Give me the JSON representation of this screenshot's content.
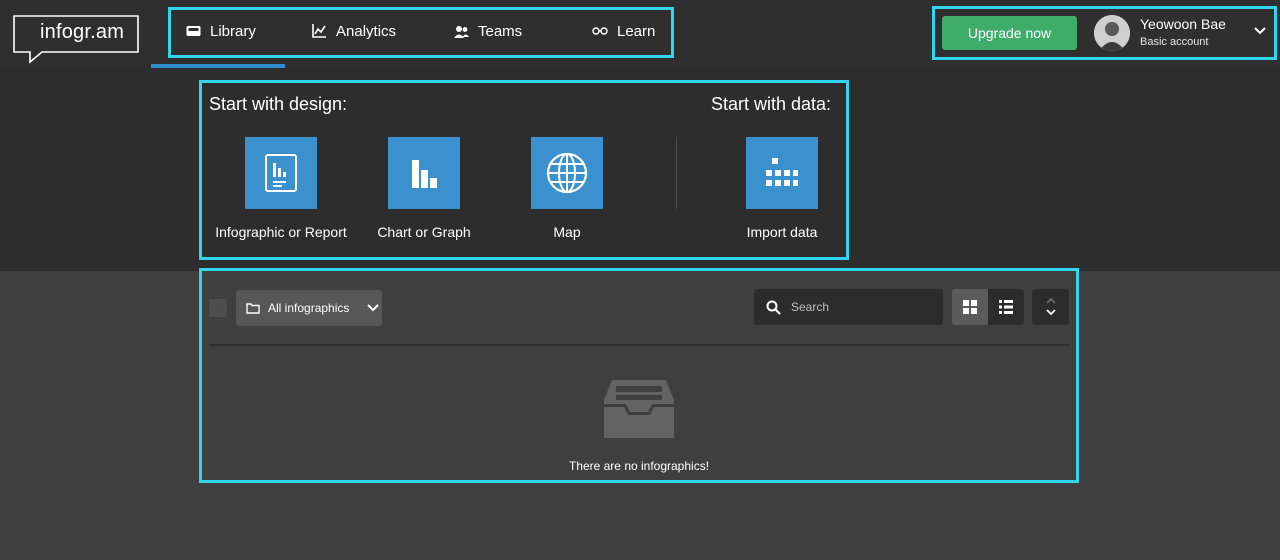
{
  "header": {
    "logo_text": "infogr.am",
    "nav": [
      {
        "label": "Library",
        "icon": "library-icon"
      },
      {
        "label": "Analytics",
        "icon": "analytics-icon"
      },
      {
        "label": "Teams",
        "icon": "teams-icon"
      },
      {
        "label": "Learn",
        "icon": "learn-icon"
      }
    ],
    "active_nav": "Library",
    "upgrade_label": "Upgrade now",
    "user": {
      "name": "Yeowoon Bae",
      "plan": "Basic account"
    }
  },
  "start": {
    "design_title": "Start with design:",
    "data_title": "Start with data:",
    "tiles": [
      {
        "label": "Infographic or Report",
        "icon": "report-icon"
      },
      {
        "label": "Chart or Graph",
        "icon": "bar-chart-icon"
      },
      {
        "label": "Map",
        "icon": "globe-icon"
      },
      {
        "label": "Import data",
        "icon": "import-grid-icon"
      }
    ]
  },
  "library": {
    "folder_label": "All infographics",
    "search_placeholder": "Search",
    "empty_message": "There are no infographics!"
  },
  "colors": {
    "accent_blue": "#3a91cd",
    "upgrade_green": "#3ead6a",
    "highlight": "#33d4f0",
    "topbar_bg": "#2f2f2f",
    "page_bg": "#3f3f3f"
  }
}
